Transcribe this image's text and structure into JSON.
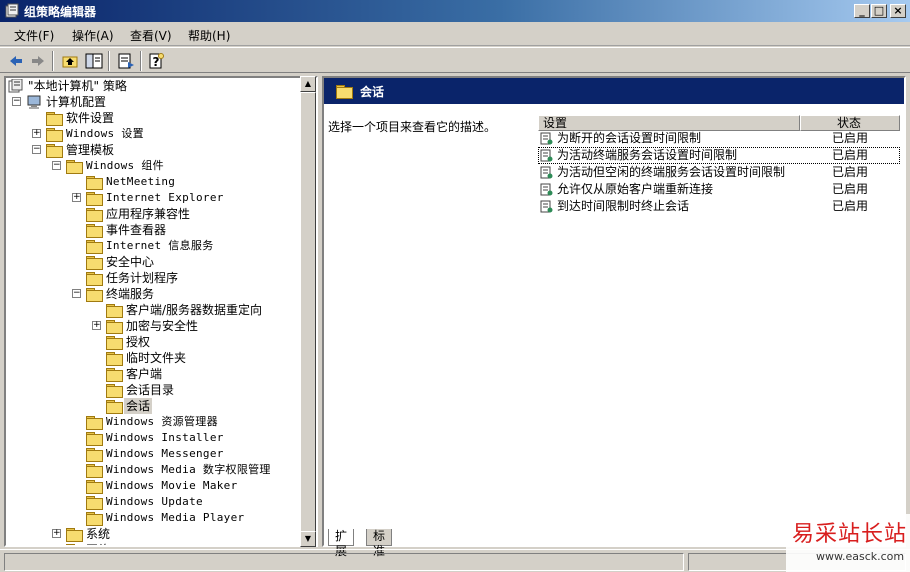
{
  "window": {
    "title": "组策略编辑器"
  },
  "menu": [
    {
      "label": "文件(F)"
    },
    {
      "label": "操作(A)"
    },
    {
      "label": "查看(V)"
    },
    {
      "label": "帮助(H)"
    }
  ],
  "toolbar": {
    "icons": [
      "back-arrow-icon",
      "forward-arrow-icon",
      "up-folder-icon",
      "show-hide-tree-icon",
      "export-list-icon",
      "help-icon"
    ]
  },
  "tree": {
    "root": "\"本地计算机\" 策略",
    "items": [
      "计算机配置",
      "软件设置",
      "Windows 设置",
      "管理模板",
      "Windows 组件",
      "NetMeeting",
      "Internet Explorer",
      "应用程序兼容性",
      "事件查看器",
      "Internet 信息服务",
      "安全中心",
      "任务计划程序",
      "终端服务",
      "客户端/服务器数据重定向",
      "加密与安全性",
      "授权",
      "临时文件夹",
      "客户端",
      "会话目录",
      "会话",
      "Windows 资源管理器",
      "Windows Installer",
      "Windows Messenger",
      "Windows Media 数字权限管理",
      "Windows Movie Maker",
      "Windows Update",
      "Windows Media Player",
      "系统",
      "网络"
    ]
  },
  "details": {
    "header_title": "会话",
    "description": "选择一个项目来查看它的描述。",
    "columns": {
      "setting": "设置",
      "state": "状态"
    },
    "rows": [
      {
        "name": "为断开的会话设置时间限制",
        "state": "已启用"
      },
      {
        "name": "为活动终端服务会话设置时间限制",
        "state": "已启用"
      },
      {
        "name": "为活动但空闲的终端服务会话设置时间限制",
        "state": "已启用"
      },
      {
        "name": "允许仅从原始客户端重新连接",
        "state": "已启用"
      },
      {
        "name": "到达时间限制时终止会话",
        "state": "已启用"
      }
    ]
  },
  "tabs": [
    {
      "label": "扩展"
    },
    {
      "label": "标准"
    }
  ],
  "watermark": {
    "text": "易采站长站",
    "url": "www.easck.com"
  }
}
